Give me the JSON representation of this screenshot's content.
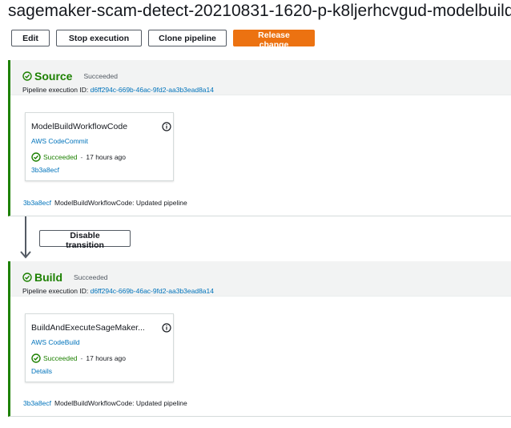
{
  "page": {
    "title": "sagemaker-scam-detect-20210831-1620-p-k8ljerhcvgud-modelbuild"
  },
  "toolbar": {
    "edit_label": "Edit",
    "stop_label": "Stop execution",
    "clone_label": "Clone pipeline",
    "release_label": "Release change"
  },
  "colors": {
    "success": "#1d8102",
    "link": "#0073bb",
    "primary": "#ec7211"
  },
  "stages": [
    {
      "name": "Source",
      "status": "Succeeded",
      "execution_label": "Pipeline execution ID:",
      "execution_id": "d6ff294c-669b-46ac-9fd2-aa3b3ead8a14",
      "action": {
        "name": "ModelBuildWorkflowCode",
        "provider": "AWS CodeCommit",
        "status": "Succeeded",
        "separator": "-",
        "time_ago": "17 hours ago",
        "link": "3b3a8ecf"
      },
      "commit": {
        "id": "3b3a8ecf",
        "message": "ModelBuildWorkflowCode: Updated pipeline"
      }
    },
    {
      "name": "Build",
      "status": "Succeeded",
      "execution_label": "Pipeline execution ID:",
      "execution_id": "d6ff294c-669b-46ac-9fd2-aa3b3ead8a14",
      "action": {
        "name": "BuildAndExecuteSageMaker...",
        "provider": "AWS CodeBuild",
        "status": "Succeeded",
        "separator": "-",
        "time_ago": "17 hours ago",
        "link": "Details"
      },
      "commit": {
        "id": "3b3a8ecf",
        "message": "ModelBuildWorkflowCode: Updated pipeline"
      }
    }
  ],
  "transition": {
    "button_label": "Disable transition",
    "icon": "arrow-down-icon"
  }
}
